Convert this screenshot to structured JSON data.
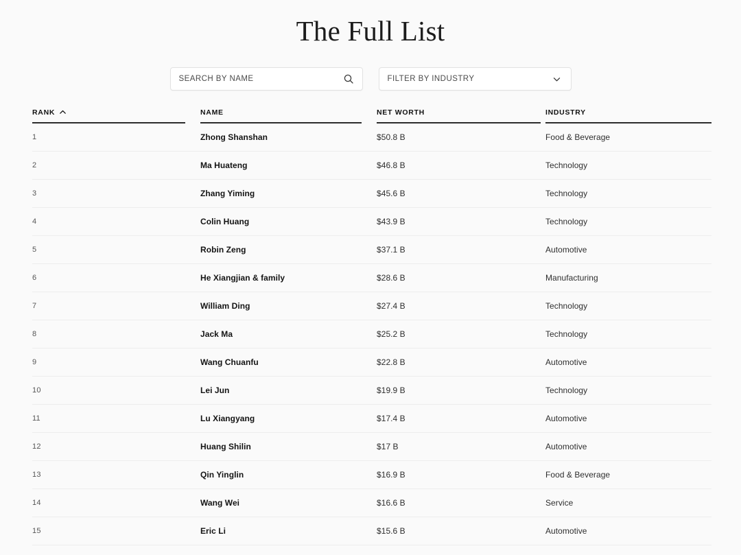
{
  "header": {
    "title": "The Full List"
  },
  "search": {
    "placeholder": "SEARCH BY NAME",
    "value": "",
    "icon": "search-icon"
  },
  "filter": {
    "label": "FILTER BY INDUSTRY",
    "icon": "chevron-down-icon"
  },
  "table": {
    "columns": [
      {
        "key": "rank",
        "label": "RANK",
        "sort": "asc",
        "sort_icon": "chevron-up-icon"
      },
      {
        "key": "name",
        "label": "NAME",
        "sort": null
      },
      {
        "key": "worth",
        "label": "NET WORTH",
        "sort": null
      },
      {
        "key": "industry",
        "label": "INDUSTRY",
        "sort": null
      }
    ],
    "rows": [
      {
        "rank": "1",
        "name": "Zhong Shanshan",
        "worth": "$50.8 B",
        "industry": "Food & Beverage"
      },
      {
        "rank": "2",
        "name": "Ma Huateng",
        "worth": "$46.8 B",
        "industry": "Technology"
      },
      {
        "rank": "3",
        "name": "Zhang Yiming",
        "worth": "$45.6 B",
        "industry": "Technology"
      },
      {
        "rank": "4",
        "name": "Colin Huang",
        "worth": "$43.9 B",
        "industry": "Technology"
      },
      {
        "rank": "5",
        "name": "Robin Zeng",
        "worth": "$37.1 B",
        "industry": "Automotive"
      },
      {
        "rank": "6",
        "name": "He Xiangjian & family",
        "worth": "$28.6 B",
        "industry": "Manufacturing"
      },
      {
        "rank": "7",
        "name": "William Ding",
        "worth": "$27.4 B",
        "industry": "Technology"
      },
      {
        "rank": "8",
        "name": "Jack Ma",
        "worth": "$25.2 B",
        "industry": "Technology"
      },
      {
        "rank": "9",
        "name": "Wang Chuanfu",
        "worth": "$22.8 B",
        "industry": "Automotive"
      },
      {
        "rank": "10",
        "name": "Lei Jun",
        "worth": "$19.9 B",
        "industry": "Technology"
      },
      {
        "rank": "11",
        "name": "Lu Xiangyang",
        "worth": "$17.4 B",
        "industry": "Automotive"
      },
      {
        "rank": "12",
        "name": "Huang Shilin",
        "worth": "$17 B",
        "industry": "Automotive"
      },
      {
        "rank": "13",
        "name": "Qin Yinglin",
        "worth": "$16.9 B",
        "industry": "Food & Beverage"
      },
      {
        "rank": "14",
        "name": "Wang Wei",
        "worth": "$16.6 B",
        "industry": "Service"
      },
      {
        "rank": "15",
        "name": "Eric Li",
        "worth": "$15.6 B",
        "industry": "Automotive"
      }
    ]
  },
  "colors": {
    "page_background": "#fafafa",
    "text_primary": "#141414",
    "text_secondary": "#2e2e2e",
    "rank_text": "#555555",
    "header_rule": "#2b2b2b",
    "row_divider": "#ededed",
    "control_border": "#e2e2e2"
  }
}
